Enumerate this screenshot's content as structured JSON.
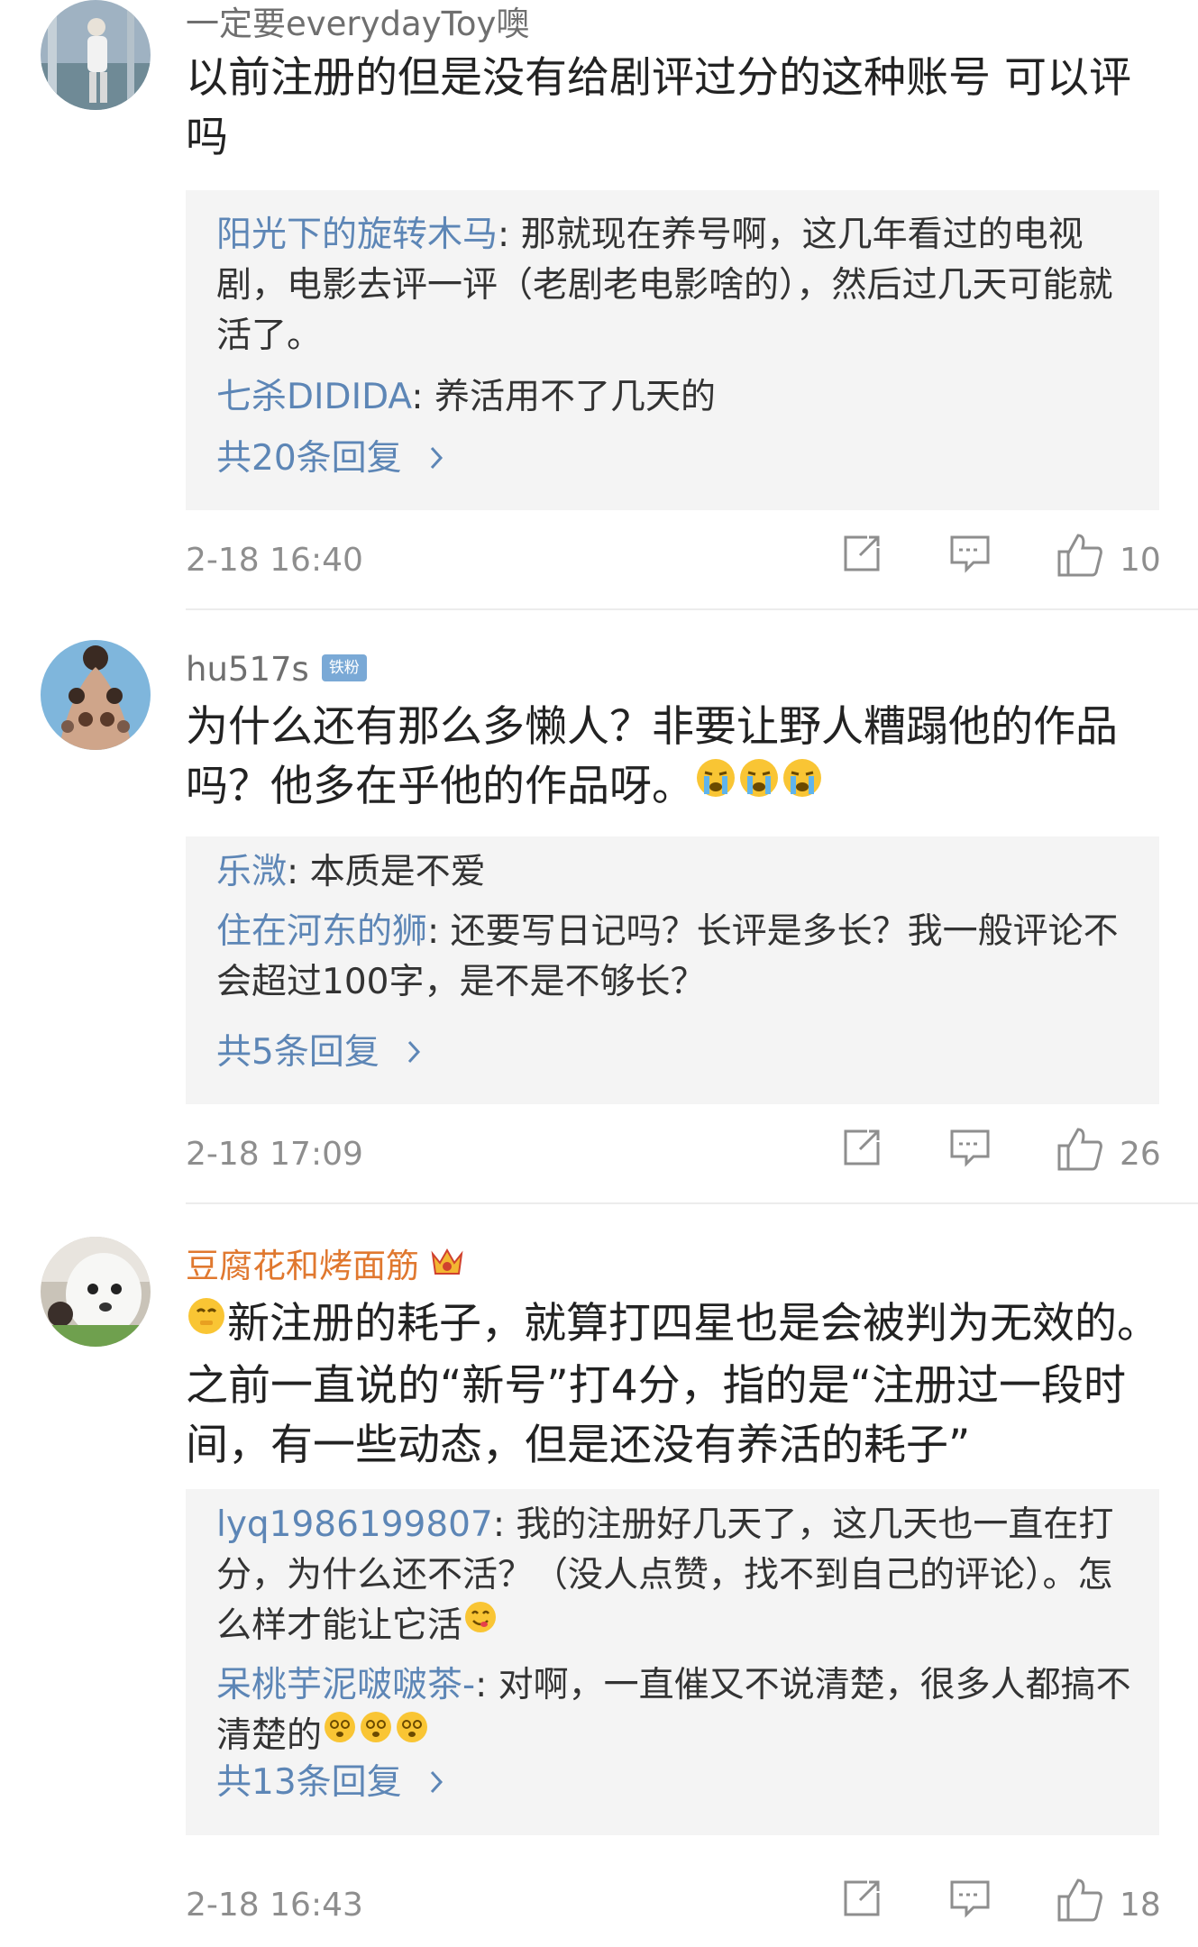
{
  "comments": [
    {
      "username": "一定要everydayToy噢",
      "text": "以前注册的但是没有给剧评过分的这种账号 可以评吗",
      "replies": [
        {
          "name": "阳光下的旋转木马",
          "sep": ": ",
          "text": "那就现在养号啊，这几年看过的电视剧，电影去评一评（老剧老电影啥的），然后过几天可能就活了。"
        },
        {
          "name": "七杀DIDIDA",
          "sep": ": ",
          "text": "养活用不了几天的"
        }
      ],
      "more_replies": "共20条回复",
      "timestamp": "2-18 16:40",
      "likes": "10"
    },
    {
      "username": "hu517s",
      "badge": "铁粉",
      "text": "为什么还有那么多懒人？非要让野人糟蹋他的作品吗？他多在乎他的作品呀。",
      "emojis": [
        "crying-emoji",
        "crying-emoji",
        "crying-emoji"
      ],
      "replies": [
        {
          "name": "乐溦",
          "sep": ": ",
          "text": "本质是不爱"
        },
        {
          "name": "住在河东的狮",
          "sep": ": ",
          "text": "还要写日记吗？长评是多长？我一般评论不会超过100字，是不是不够长？"
        }
      ],
      "more_replies": "共5条回复",
      "timestamp": "2-18 17:09",
      "likes": "26"
    },
    {
      "username": "豆腐花和烤面筋",
      "text": "新注册的耗子，就算打四星也是会被判为无效的。之前一直说的“新号”打4分，指的是“注册过一段时间，有一些动态，但是还没有养活的耗子”",
      "replies": [
        {
          "name": "lyq1986199807",
          "sep": ": ",
          "text": "我的注册好几天了，这几天也一直在打分，为什么还不活？（没人点赞，找不到自己的评论）。怎么样才能让它活"
        },
        {
          "name": "呆桃芋泥啵啵茶-",
          "sep": ": ",
          "text": "对啊，一直催又不说清楚，很多人都搞不清楚的"
        }
      ],
      "more_replies": "共13条回复",
      "timestamp": "2-18 16:43",
      "likes": "18"
    }
  ],
  "colors": {
    "link_blue": "#5d86b6",
    "vip_orange": "#e0782f",
    "meta_gray": "#8e8e8e",
    "reply_bg": "#f4f4f4"
  }
}
